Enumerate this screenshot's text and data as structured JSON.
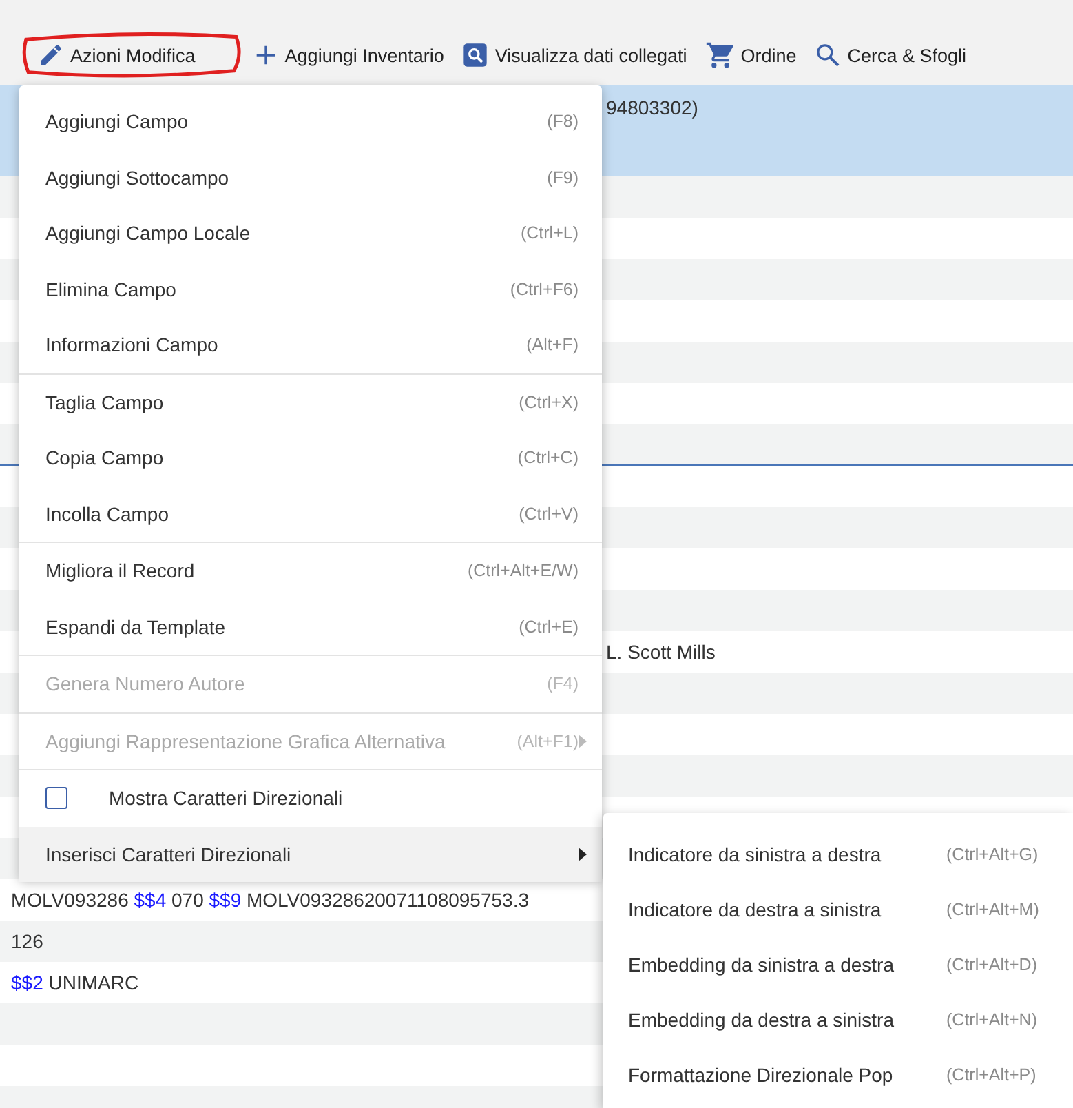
{
  "toolbar": {
    "items": [
      {
        "kind": "pencil",
        "label": "Azioni Modifica",
        "circled": true
      },
      {
        "kind": "plus",
        "label": "Aggiungi Inventario",
        "circled": false
      },
      {
        "kind": "lookup",
        "label": "Visualizza dati collegati",
        "circled": false
      },
      {
        "kind": "cart",
        "label": "Ordine",
        "circled": false
      },
      {
        "kind": "search",
        "label": "Cerca & Sfogli",
        "circled": false
      }
    ]
  },
  "record_rows": [
    {
      "kind": "selected",
      "segments": [
        {
          "text": "94803302)",
          "subfield": false
        }
      ]
    },
    {
      "kind": "blank"
    },
    {
      "kind": "blank"
    },
    {
      "kind": "blank"
    },
    {
      "kind": "blank"
    },
    {
      "kind": "blank"
    },
    {
      "kind": "blank"
    },
    {
      "kind": "blank"
    },
    {
      "kind": "blank"
    },
    {
      "kind": "blank"
    },
    {
      "kind": "blank"
    },
    {
      "kind": "blank"
    },
    {
      "kind": "continued",
      "segments": [
        {
          "text": "L. Scott Mills",
          "subfield": false
        }
      ]
    },
    {
      "kind": "blank"
    },
    {
      "kind": "blank"
    },
    {
      "kind": "blank"
    },
    {
      "kind": "blank"
    },
    {
      "kind": "blank"
    },
    {
      "kind": "text",
      "segments": [
        {
          "text": "MOLV093286 ",
          "subfield": false
        },
        {
          "text": "$$4",
          "subfield": true
        },
        {
          "text": " 070 ",
          "subfield": false
        },
        {
          "text": "$$9",
          "subfield": true
        },
        {
          "text": " MOLV09328620071108095753.3",
          "subfield": false
        }
      ]
    },
    {
      "kind": "text",
      "segments": [
        {
          "text": "126",
          "subfield": false
        }
      ]
    },
    {
      "kind": "text",
      "segments": [
        {
          "text": "$$2",
          "subfield": true
        },
        {
          "text": " UNIMARC",
          "subfield": false
        }
      ]
    },
    {
      "kind": "blank"
    },
    {
      "kind": "blank"
    },
    {
      "kind": "blank"
    }
  ],
  "menu": {
    "groups": [
      [
        {
          "kind": "item",
          "label": "Aggiungi Campo",
          "shortcut": "(F8)",
          "disabled": false
        },
        {
          "kind": "item",
          "label": "Aggiungi Sottocampo",
          "shortcut": "(F9)",
          "disabled": false
        },
        {
          "kind": "item",
          "label": "Aggiungi Campo Locale",
          "shortcut": "(Ctrl+L)",
          "disabled": false
        },
        {
          "kind": "item",
          "label": "Elimina Campo",
          "shortcut": "(Ctrl+F6)",
          "disabled": false
        },
        {
          "kind": "item",
          "label": "Informazioni Campo",
          "shortcut": "(Alt+F)",
          "disabled": false
        }
      ],
      [
        {
          "kind": "item",
          "label": "Taglia Campo",
          "shortcut": "(Ctrl+X)",
          "disabled": false
        },
        {
          "kind": "item",
          "label": "Copia Campo",
          "shortcut": "(Ctrl+C)",
          "disabled": false
        },
        {
          "kind": "item",
          "label": "Incolla Campo",
          "shortcut": "(Ctrl+V)",
          "disabled": false
        }
      ],
      [
        {
          "kind": "item",
          "label": "Migliora il Record",
          "shortcut": "(Ctrl+Alt+E/W)",
          "disabled": false
        },
        {
          "kind": "item",
          "label": "Espandi da Template",
          "shortcut": "(Ctrl+E)",
          "disabled": false
        }
      ],
      [
        {
          "kind": "item",
          "label": "Genera Numero Autore",
          "shortcut": "(F4)",
          "disabled": true
        }
      ],
      [
        {
          "kind": "submenu",
          "label": "Aggiungi Rappresentazione Grafica Alternativa",
          "shortcut": "(Alt+F1)",
          "disabled": true,
          "expanded": false
        }
      ],
      [
        {
          "kind": "checkbox",
          "label": "Mostra Caratteri Direzionali",
          "checked": false,
          "disabled": false
        },
        {
          "kind": "submenu",
          "label": "Inserisci Caratteri Direzionali",
          "disabled": false,
          "expanded": true
        }
      ]
    ]
  },
  "submenu": {
    "items": [
      {
        "label": "Indicatore da sinistra a destra",
        "shortcut": "(Ctrl+Alt+G)"
      },
      {
        "label": "Indicatore da destra a sinistra",
        "shortcut": "(Ctrl+Alt+M)"
      },
      {
        "label": "Embedding da sinistra a destra",
        "shortcut": "(Ctrl+Alt+D)"
      },
      {
        "label": "Embedding da destra a sinistra",
        "shortcut": "(Ctrl+Alt+N)"
      },
      {
        "label": "Formattazione Direzionale Pop",
        "shortcut": "(Ctrl+Alt+P)"
      }
    ]
  }
}
